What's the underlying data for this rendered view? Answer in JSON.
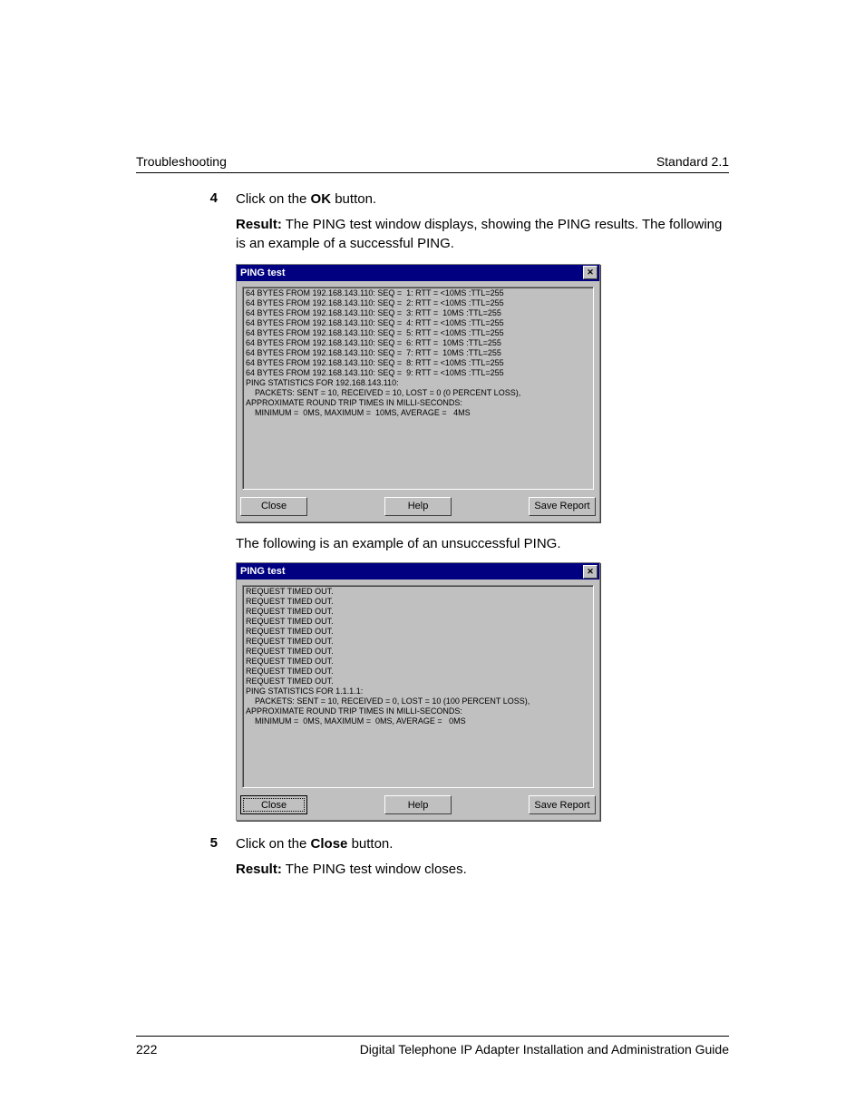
{
  "header": {
    "left": "Troubleshooting",
    "right": "Standard 2.1"
  },
  "step4": {
    "num": "4",
    "text_pre": "Click on the ",
    "text_bold": "OK",
    "text_post": " button.",
    "result_label": "Result:",
    "result_text": " The PING test window displays, showing the PING results. The following is an example of a successful PING."
  },
  "dlg1": {
    "title": "PING test",
    "close_glyph": "✕",
    "lines": "64 BYTES FROM 192.168.143.110: SEQ =  1: RTT = <10MS :TTL=255\n64 BYTES FROM 192.168.143.110: SEQ =  2: RTT = <10MS :TTL=255\n64 BYTES FROM 192.168.143.110: SEQ =  3: RTT =  10MS :TTL=255\n64 BYTES FROM 192.168.143.110: SEQ =  4: RTT = <10MS :TTL=255\n64 BYTES FROM 192.168.143.110: SEQ =  5: RTT = <10MS :TTL=255\n64 BYTES FROM 192.168.143.110: SEQ =  6: RTT =  10MS :TTL=255\n64 BYTES FROM 192.168.143.110: SEQ =  7: RTT =  10MS :TTL=255\n64 BYTES FROM 192.168.143.110: SEQ =  8: RTT = <10MS :TTL=255\n64 BYTES FROM 192.168.143.110: SEQ =  9: RTT = <10MS :TTL=255\nPING STATISTICS FOR 192.168.143.110:\n    PACKETS: SENT = 10, RECEIVED = 10, LOST = 0 (0 PERCENT LOSS),\nAPPROXIMATE ROUND TRIP TIMES IN MILLI-SECONDS:\n    MINIMUM =  0MS, MAXIMUM =  10MS, AVERAGE =   4MS",
    "btn_close": "Close",
    "btn_help": "Help",
    "btn_save": "Save Report"
  },
  "between_text": "The following is an example of an unsuccessful PING.",
  "dlg2": {
    "title": "PING test",
    "close_glyph": "✕",
    "lines": "REQUEST TIMED OUT.\nREQUEST TIMED OUT.\nREQUEST TIMED OUT.\nREQUEST TIMED OUT.\nREQUEST TIMED OUT.\nREQUEST TIMED OUT.\nREQUEST TIMED OUT.\nREQUEST TIMED OUT.\nREQUEST TIMED OUT.\nREQUEST TIMED OUT.\nPING STATISTICS FOR 1.1.1.1:\n    PACKETS: SENT = 10, RECEIVED = 0, LOST = 10 (100 PERCENT LOSS),\nAPPROXIMATE ROUND TRIP TIMES IN MILLI-SECONDS:\n    MINIMUM =  0MS, MAXIMUM =  0MS, AVERAGE =   0MS",
    "btn_close": "Close",
    "btn_help": "Help",
    "btn_save": "Save Report"
  },
  "step5": {
    "num": "5",
    "text_pre": "Click on the ",
    "text_bold": "Close",
    "text_post": " button.",
    "result_label": "Result:",
    "result_text": " The PING test window closes."
  },
  "footer": {
    "page": "222",
    "title": "Digital Telephone IP Adapter Installation and Administration Guide"
  }
}
